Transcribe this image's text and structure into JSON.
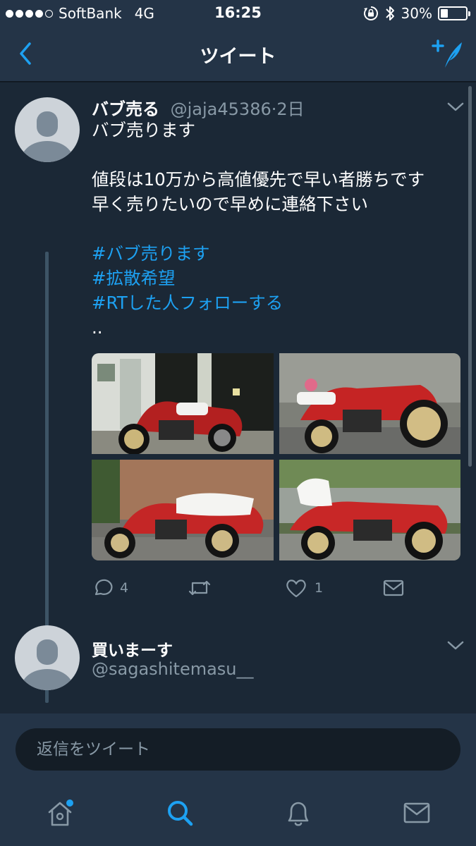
{
  "status_bar": {
    "carrier": "SoftBank",
    "network": "4G",
    "time": "16:25",
    "battery": "30%",
    "battery_level": 0.3
  },
  "nav": {
    "title": "ツイート",
    "back_icon": "chevron-left-icon",
    "compose_icon": "compose-tweet-icon"
  },
  "tweet": {
    "name": "バブ売る",
    "handle": "@jaja45386",
    "separator": "·",
    "time": "2日",
    "lines": [
      "バブ売ります",
      "",
      "値段は10万から高値優先で早い者勝ちです",
      "早く売りたいので早めに連絡下さい",
      ""
    ],
    "hashtags": [
      "#バブ売ります",
      "#拡散希望",
      "#RTした人フォローする"
    ],
    "trailing": "..",
    "actions": {
      "reply_count": "4",
      "retweet_count": "",
      "like_count": "1"
    }
  },
  "reply": {
    "name": "買いまーす",
    "handle": "@sagashitemasu__"
  },
  "reply_box": {
    "placeholder": "返信をツイート"
  },
  "tabs": [
    "home-icon",
    "search-icon",
    "notifications-icon",
    "messages-icon"
  ],
  "colors": {
    "accent": "#1da1f2",
    "background": "#1b2836",
    "bar": "#243447",
    "muted": "#8899a6"
  }
}
